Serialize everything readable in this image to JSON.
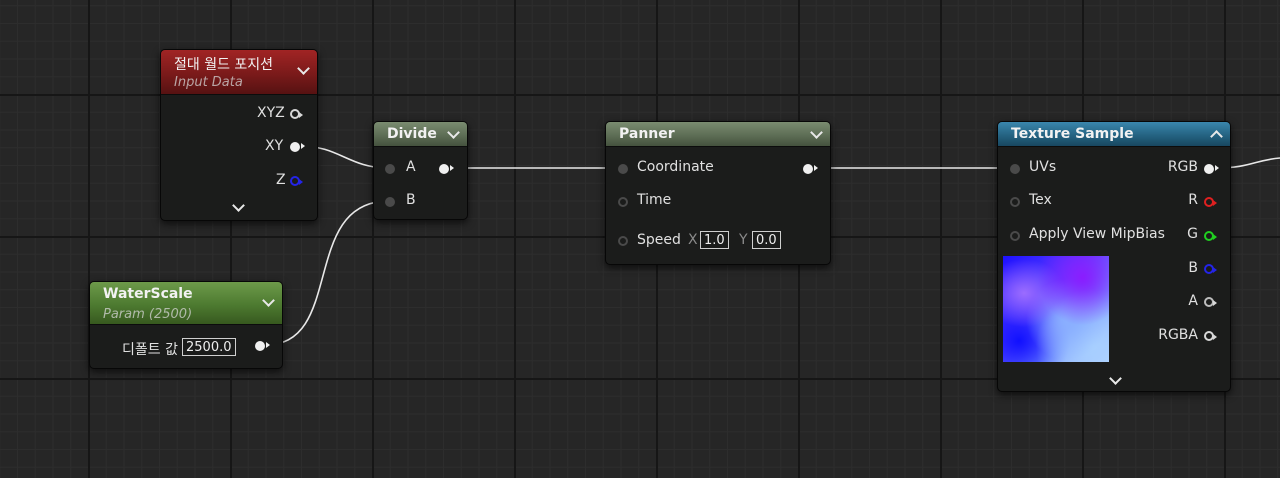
{
  "nodes": {
    "world_position": {
      "title": "절대 월드 포지션",
      "subtitle": "Input Data",
      "outputs": [
        "XYZ",
        "XY",
        "Z"
      ]
    },
    "water_scale": {
      "title": "WaterScale",
      "subtitle": "Param (2500)",
      "default_label": "디폴트 값",
      "default_value": "2500.0"
    },
    "divide": {
      "title": "Divide",
      "inputs": [
        "A",
        "B"
      ]
    },
    "panner": {
      "title": "Panner",
      "inputs": [
        "Coordinate",
        "Time",
        "Speed"
      ],
      "speed_x_label": "X",
      "speed_x": "1.0",
      "speed_y_label": "Y",
      "speed_y": "0.0"
    },
    "texture_sample": {
      "title": "Texture Sample",
      "inputs": [
        "UVs",
        "Tex",
        "Apply View MipBias"
      ],
      "outputs": [
        "RGB",
        "R",
        "G",
        "B",
        "A",
        "RGBA"
      ]
    }
  },
  "colors": {
    "input_data_header": "#7a1a1a",
    "param_header": "#4d7a30",
    "math_header": "#5b6b53",
    "texture_header": "#23607e",
    "pin_red": "#e02020",
    "pin_green": "#20d020",
    "pin_blue": "#2424e8",
    "wire": "#e8e8e8"
  }
}
